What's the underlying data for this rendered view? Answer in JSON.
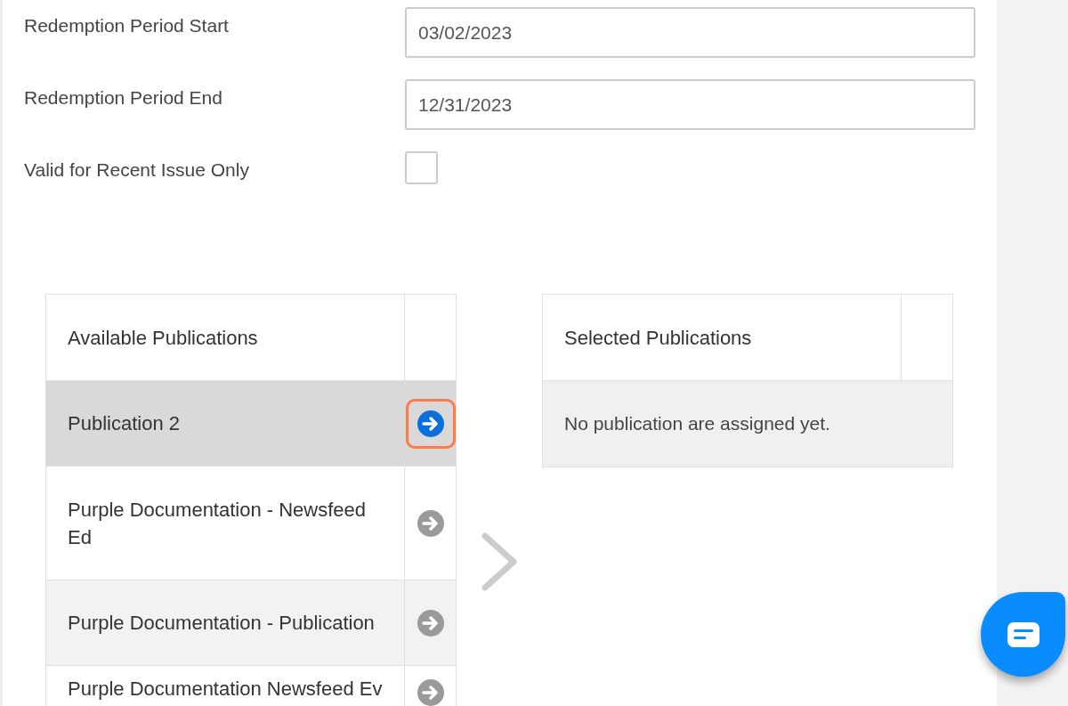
{
  "fields": [
    {
      "kind": "date",
      "label": "Redemption Period Start",
      "value": "03/02/2023"
    },
    {
      "kind": "date",
      "label": "Redemption Period End",
      "value": "12/31/2023"
    },
    {
      "kind": "checkbox",
      "label": "Valid for Recent Issue Only",
      "checked": false
    }
  ],
  "available": {
    "title": "Available Publications",
    "rows": [
      {
        "name": "Publication 2",
        "selected": true,
        "highlighted": true
      },
      {
        "name": "Purple Documentation - Newsfeed Ed",
        "selected": false,
        "highlighted": false
      },
      {
        "name": "Purple Documentation - Publication",
        "selected": false,
        "highlighted": false
      },
      {
        "name": "Purple Documentation Newsfeed Ev",
        "selected": false,
        "highlighted": false
      }
    ]
  },
  "selected_list": {
    "title": "Selected Publications",
    "empty_message": "No publication are assigned yet."
  }
}
